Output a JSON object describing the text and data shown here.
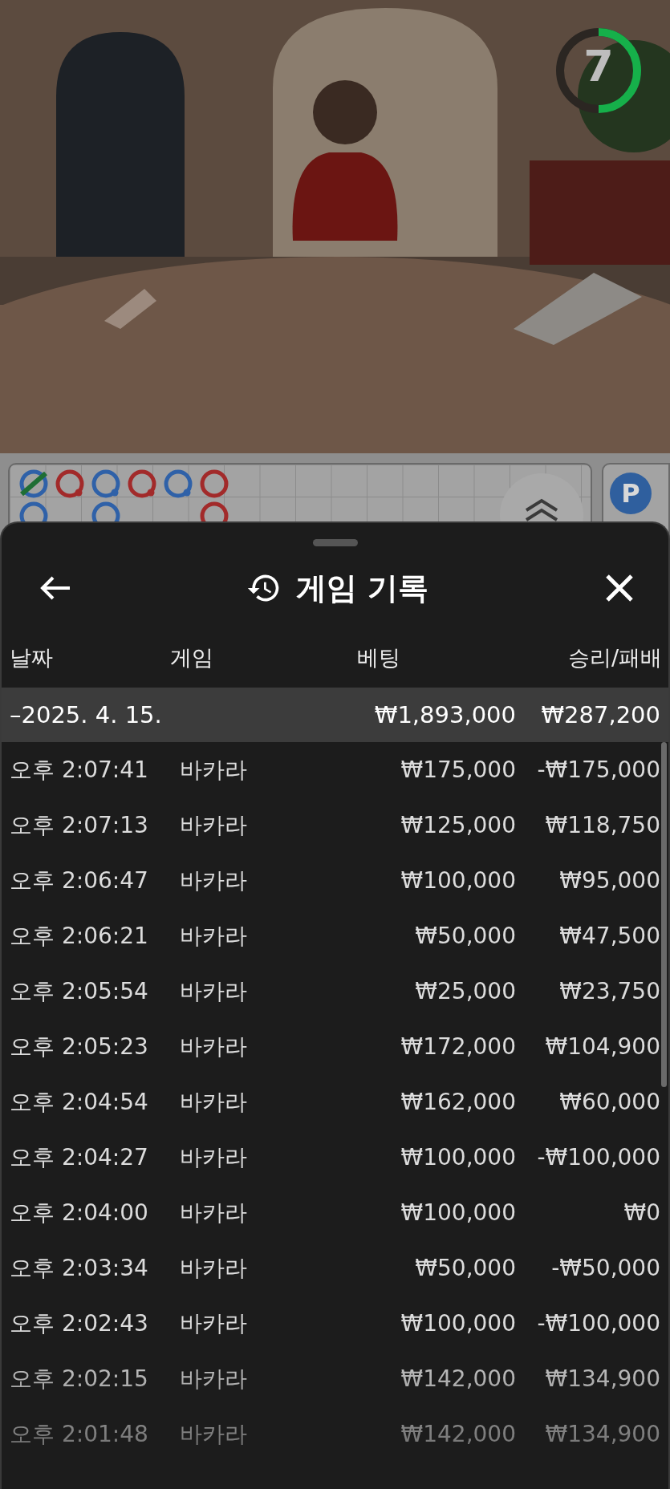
{
  "video": {
    "kind": "picture",
    "timer": {
      "value": "7",
      "level": 0.5
    }
  },
  "roadmap": {
    "columns": [
      [
        {
          "color": "#2f61a8",
          "pair": false,
          "tie": true
        },
        {
          "color": "#2f61a8",
          "pair": false,
          "tie": false
        }
      ],
      [
        {
          "color": "#a22a2a",
          "pair": true,
          "tie": false
        }
      ],
      [
        {
          "color": "#2f61a8",
          "pair": true,
          "tie": false
        },
        {
          "color": "#2f61a8",
          "pair": false,
          "tie": false
        }
      ],
      [
        {
          "color": "#a22a2a",
          "pair": true,
          "tie": false
        }
      ],
      [
        {
          "color": "#2f61a8",
          "pair": true,
          "tie": false
        }
      ],
      [
        {
          "color": "#a22a2a",
          "pair": false,
          "tie": false
        },
        {
          "color": "#a22a2a",
          "pair": false,
          "tie": false
        }
      ]
    ],
    "side_badge": "P"
  },
  "sheet": {
    "title": "게임 기록",
    "columns": [
      "날짜",
      "게임",
      "베팅",
      "승리/패배"
    ],
    "summary": {
      "date": "–2025. 4. 15.",
      "bet": "₩1,893,000",
      "result": "₩287,200"
    },
    "rows": [
      {
        "time": "오후 2:07:41",
        "game": "바카라",
        "bet": "₩175,000",
        "result": "-₩175,000"
      },
      {
        "time": "오후 2:07:13",
        "game": "바카라",
        "bet": "₩125,000",
        "result": "₩118,750"
      },
      {
        "time": "오후 2:06:47",
        "game": "바카라",
        "bet": "₩100,000",
        "result": "₩95,000"
      },
      {
        "time": "오후 2:06:21",
        "game": "바카라",
        "bet": "₩50,000",
        "result": "₩47,500"
      },
      {
        "time": "오후 2:05:54",
        "game": "바카라",
        "bet": "₩25,000",
        "result": "₩23,750"
      },
      {
        "time": "오후 2:05:23",
        "game": "바카라",
        "bet": "₩172,000",
        "result": "₩104,900"
      },
      {
        "time": "오후 2:04:54",
        "game": "바카라",
        "bet": "₩162,000",
        "result": "₩60,000"
      },
      {
        "time": "오후 2:04:27",
        "game": "바카라",
        "bet": "₩100,000",
        "result": "-₩100,000"
      },
      {
        "time": "오후 2:04:00",
        "game": "바카라",
        "bet": "₩100,000",
        "result": "₩0"
      },
      {
        "time": "오후 2:03:34",
        "game": "바카라",
        "bet": "₩50,000",
        "result": "-₩50,000"
      },
      {
        "time": "오후 2:02:43",
        "game": "바카라",
        "bet": "₩100,000",
        "result": "-₩100,000"
      },
      {
        "time": "오후 2:02:15",
        "game": "바카라",
        "bet": "₩142,000",
        "result": "₩134,900"
      },
      {
        "time": "오후 2:01:48",
        "game": "바카라",
        "bet": "₩142,000",
        "result": "₩134,900"
      }
    ]
  }
}
